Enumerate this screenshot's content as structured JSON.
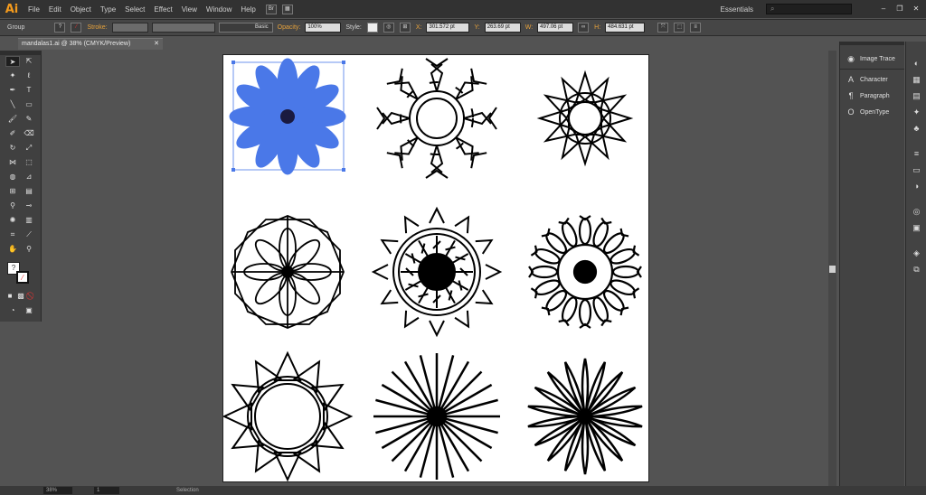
{
  "app": {
    "logo": "Ai"
  },
  "menu": [
    "File",
    "Edit",
    "Object",
    "Type",
    "Select",
    "Effect",
    "View",
    "Window",
    "Help"
  ],
  "workspace": "Essentials",
  "search_placeholder": "",
  "window_controls": [
    "–",
    "❐",
    "✕"
  ],
  "control_bar": {
    "selection_type": "Group",
    "stroke_label": "Stroke:",
    "brush_label": "Basic",
    "opacity_label": "Opacity:",
    "opacity_value": "100%",
    "style_label": "Style:",
    "x_label": "X:",
    "x_value": "301.572 pt",
    "y_label": "Y:",
    "y_value": "263.69 pt",
    "w_label": "W:",
    "w_value": "497.06 pt",
    "h_label": "H:",
    "h_value": "484.631 pt"
  },
  "document_tab": {
    "title": "mandalas1.ai @ 38% (CMYK/Preview)",
    "close": "✕"
  },
  "panels": {
    "items": [
      {
        "label": "Image Trace",
        "icon": "image-trace-icon"
      },
      {
        "label": "Character",
        "icon": "character-icon"
      },
      {
        "label": "Paragraph",
        "icon": "paragraph-icon"
      },
      {
        "label": "OpenType",
        "icon": "opentype-icon"
      }
    ]
  },
  "status_bar": {
    "zoom": "38%",
    "page": "1",
    "tool": "Selection"
  },
  "colors": {
    "accent": "#f59b1d",
    "selection": "#4a78e8",
    "artboard": "#ffffff"
  }
}
